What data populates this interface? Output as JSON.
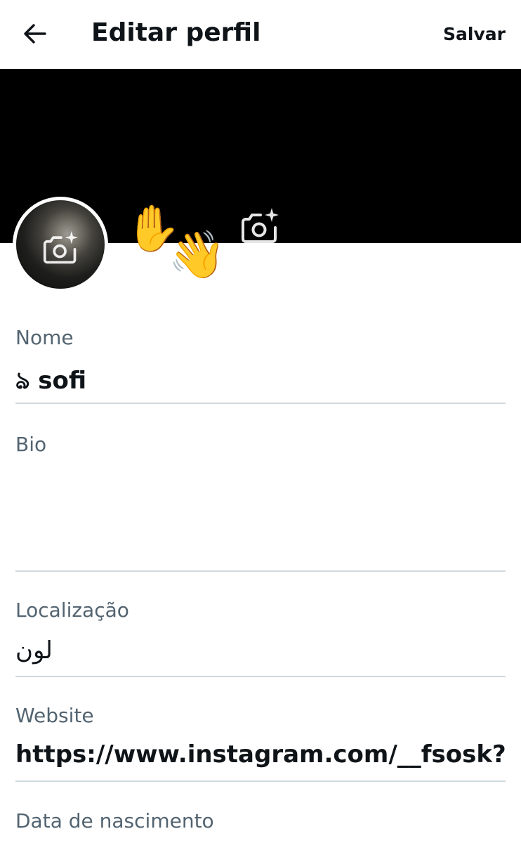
{
  "header": {
    "back_icon": "arrow-left-icon",
    "title": "Editar perfil",
    "save_label": "Salvar"
  },
  "banner": {
    "background_color": "#000000",
    "camera_icon": "camera-add-icon"
  },
  "avatar": {
    "camera_icon": "camera-add-icon"
  },
  "decorations": {
    "raised_hand": "✋",
    "waving_hand": "👋"
  },
  "fields": {
    "name": {
      "label": "Nome",
      "value": "ঌ sofi"
    },
    "bio": {
      "label": "Bio",
      "value": ""
    },
    "location": {
      "label": "Localização",
      "value": "لون"
    },
    "website": {
      "label": "Website",
      "value": "https://www.instagram.com/__fsosk?i"
    },
    "birthdate": {
      "label": "Data de nascimento"
    }
  },
  "colors": {
    "text_primary": "#0f1419",
    "text_secondary": "#536471",
    "divider": "#cfd9de"
  }
}
